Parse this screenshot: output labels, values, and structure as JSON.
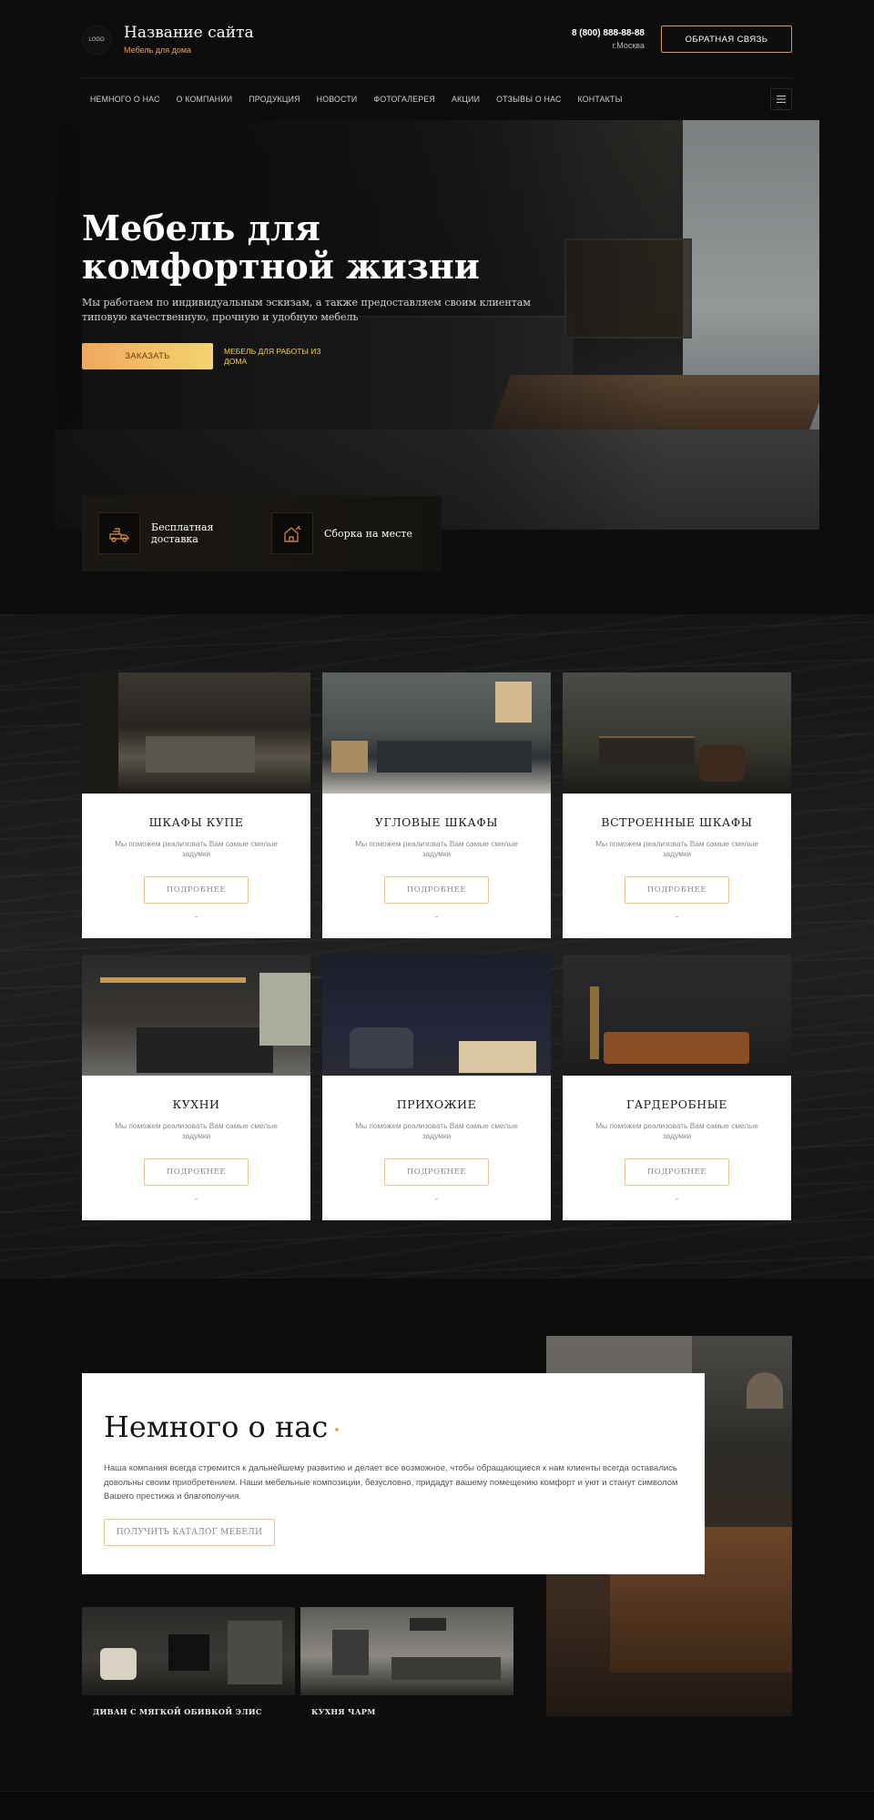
{
  "header": {
    "logo_text": "LOGO",
    "site_title": "Название сайта",
    "site_subtitle": "Мебель для дома",
    "phone": "8 (800) 888-88-88",
    "city": "г.Москва",
    "callback_label": "ОБРАТНАЯ СВЯЗЬ"
  },
  "nav": {
    "items": [
      "НЕМНОГО О НАС",
      "О КОМПАНИИ",
      "ПРОДУКЦИЯ",
      "НОВОСТИ",
      "ФОТОГАЛЕРЕЯ",
      "АКЦИИ",
      "ОТЗЫВЫ О НАС",
      "КОНТАКТЫ"
    ],
    "menu_icon": "hamburger-icon"
  },
  "hero": {
    "title": "Мебель для комфортной жизни",
    "text": "Мы работаем по индивидуальным эскизам, а также предоставляем своим клиентам типовую качественную, прочную и удобную мебель",
    "order_label": "ЗАКАЗАТЬ",
    "link_label": "МЕБЕЛЬ ДЛЯ РАБОТЫ ИЗ ДОМА",
    "features": [
      {
        "icon": "delivery-icon",
        "label": "Бесплатная доставка"
      },
      {
        "icon": "assembly-icon",
        "label": "Сборка на месте"
      }
    ]
  },
  "products": {
    "cards": [
      {
        "title": "ШКАФЫ КУПЕ",
        "desc": "Мы поможем реализовать Вам самые смелые задумки",
        "button": "ПОДРОБНЕЕ"
      },
      {
        "title": "УГЛОВЫЕ ШКАФЫ",
        "desc": "Мы поможем реализовать Вам самые смелые задумки",
        "button": "ПОДРОБНЕЕ"
      },
      {
        "title": "ВСТРОЕННЫЕ ШКАФЫ",
        "desc": "Мы поможем реализовать Вам самые смелые задумки",
        "button": "ПОДРОБНЕЕ"
      },
      {
        "title": "КУХНИ",
        "desc": "Мы поможем реализовать Вам самые смелые задумки",
        "button": "ПОДРОБНЕЕ"
      },
      {
        "title": "ПРИХОЖИЕ",
        "desc": "Мы поможем реализовать Вам самые смелые задумки",
        "button": "ПОДРОБНЕЕ"
      },
      {
        "title": "ГАРДЕРОБНЫЕ",
        "desc": "Мы поможем реализовать Вам самые смелые задумки",
        "button": "ПОДРОБНЕЕ"
      }
    ]
  },
  "about": {
    "title": "Немного о нас",
    "text": "Наша компания всегда стремится к дальнейшему развитию и делает все возможное, чтобы обращающиеся к нам клиенты всегда оставались довольны своим приобретением. Наши мебельные композиции, безусловно, придадут вашему помещению комфорт и уют и станут символом Вашего престижа и благополучия.",
    "catalog_label": "ПОЛУЧИТЬ КАТАЛОГ МЕБЕЛИ"
  },
  "featured": {
    "items": [
      {
        "name": "ДИВАН С МЯГКОЙ ОБИВКОЙ ЭЛИС"
      },
      {
        "name": "КУХНЯ ЧАРМ"
      }
    ]
  },
  "colors": {
    "accent": "#e5a15a",
    "accent_gold": "#f3cd60",
    "page_bg": "#0d0d0d"
  }
}
